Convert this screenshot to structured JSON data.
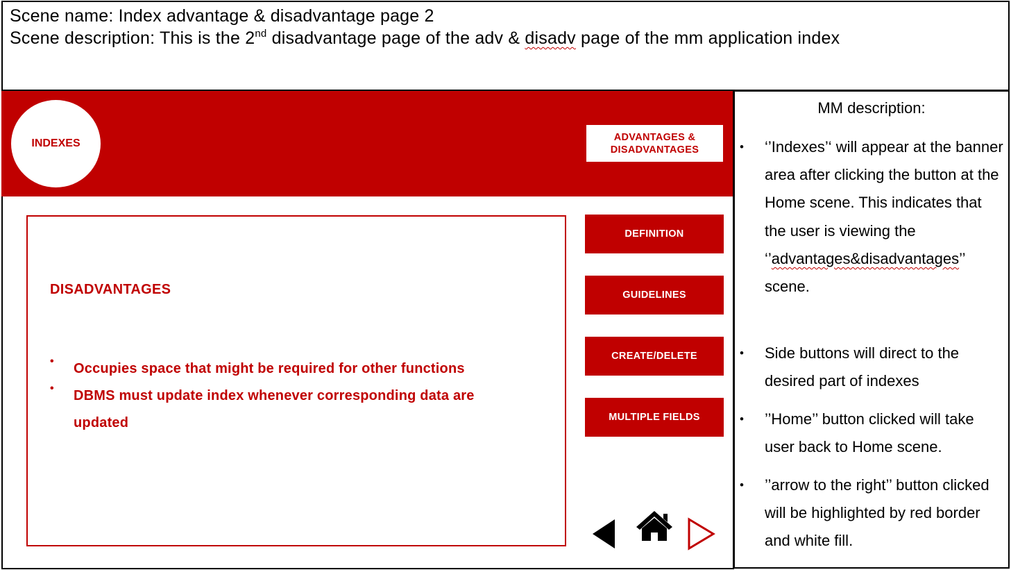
{
  "header": {
    "scene_name": "Scene name: Index advantage & disadvantage page 2",
    "scene_desc_pre": "Scene description: This is the 2",
    "scene_desc_sup": "nd",
    "scene_desc_mid": " disadvantage page of the adv & ",
    "scene_desc_squig": "disadv",
    "scene_desc_post": " page of the mm application index"
  },
  "banner": {
    "logo_text": "INDEXES",
    "scene_tag": "ADVANTAGES & DISADVANTAGES"
  },
  "content": {
    "title": "DISADVANTAGES",
    "bullets": [
      "Occupies space that might be required for other functions",
      "DBMS must update index whenever corresponding data are updated"
    ]
  },
  "side_buttons": {
    "definition": "DEFINITION",
    "guidelines": "GUIDELINES",
    "create_delete": "CREATE/DELETE",
    "multiple_fields": "MULTIPLE FIELDS"
  },
  "nav": {
    "back_icon": "triangle-left-icon",
    "home_icon": "home-icon",
    "next_icon": "triangle-right-outline-icon"
  },
  "description": {
    "title": "MM description:",
    "item1_pre": "‘’Indexes’‘ will appear at the banner area after clicking the button at the  Home scene. This indicates that the user is viewing the ‘’",
    "item1_squig": "advantages&disadvantages",
    "item1_post": "’’ scene.",
    "item2": "Side buttons will direct to the desired part of indexes",
    "item3": "’’Home’’ button clicked will take user back to Home scene.",
    "item4": "’’arrow to the right’’ button clicked will be highlighted by red border and white fill."
  },
  "colors": {
    "accent": "#c00000",
    "background": "#ffffff",
    "text": "#000000"
  }
}
